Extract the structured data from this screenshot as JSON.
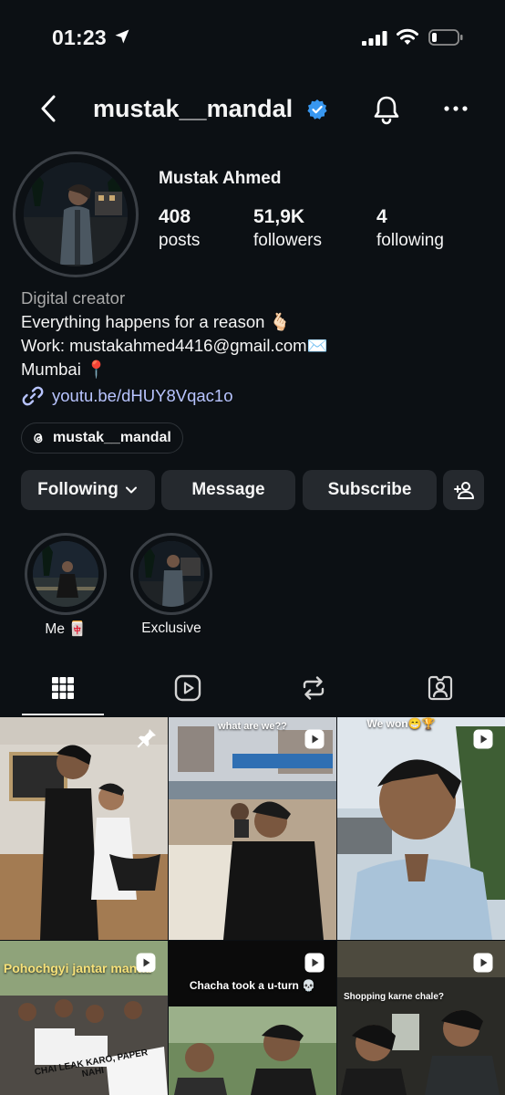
{
  "status_bar": {
    "time": "01:23"
  },
  "header": {
    "username": "mustak__mandal"
  },
  "profile": {
    "display_name": "Mustak Ahmed",
    "stats": [
      {
        "value": "408",
        "label": "posts"
      },
      {
        "value": "51,9K",
        "label": "followers"
      },
      {
        "value": "4",
        "label": "following"
      }
    ],
    "category": "Digital creator",
    "bio_lines": [
      "Everything happens for a reason 🫰🏻",
      "Work: mustakahmed4416@gmail.com✉️",
      "Mumbai 📍"
    ],
    "link": "youtu.be/dHUY8Vqac1o",
    "threads_handle": "mustak__mandal"
  },
  "actions": {
    "following_label": "Following",
    "message_label": "Message",
    "subscribe_label": "Subscribe"
  },
  "highlights": [
    {
      "label": "Me 🀄"
    },
    {
      "label": "Exclusive"
    }
  ],
  "tabs": [
    {
      "icon": "grid-icon",
      "active": true
    },
    {
      "icon": "reels-icon",
      "active": false
    },
    {
      "icon": "reposts-icon",
      "active": false
    },
    {
      "icon": "tagged-icon",
      "active": false
    }
  ],
  "posts": [
    {
      "overlay": "",
      "badge": "pin-icon"
    },
    {
      "overlay": "what are we??",
      "badge": "reel-icon"
    },
    {
      "overlay": "We won😁🏆",
      "badge": "reel-icon"
    },
    {
      "overlay": "Pohochgyi jantar mantar",
      "sign_text": "CHAI LEAK KARO, PAPER NAHI",
      "badge": "reel-icon"
    },
    {
      "overlay": "Chacha took a u-turn 💀",
      "badge": "reel-icon"
    },
    {
      "overlay": "Shopping karne chale?",
      "badge": "reel-icon"
    }
  ],
  "colors": {
    "background": "#0c1014",
    "button": "#25292e",
    "link": "#b8c4ff",
    "verified": "#3897f0",
    "secondary_text": "#a8a8a8"
  }
}
